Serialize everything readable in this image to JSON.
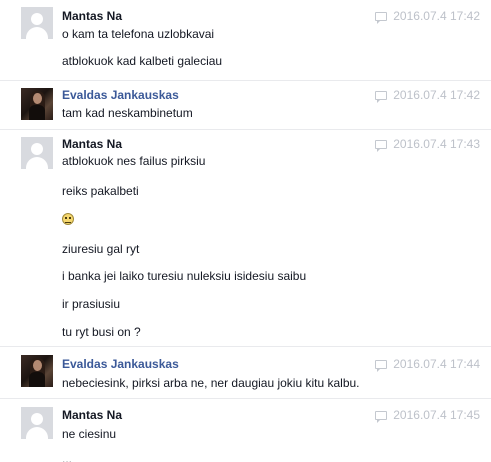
{
  "messages": [
    {
      "sender": "Mantas Na",
      "timestamp": "2016.07.4 17:42",
      "lines": [
        "o kam ta telefona uzlobkavai",
        "atblokuok kad kalbeti galeciau"
      ]
    },
    {
      "sender": "Evaldas Jankauskas",
      "timestamp": "2016.07.4 17:42",
      "lines": [
        "tam kad neskambinetum"
      ]
    },
    {
      "sender": "Mantas Na",
      "timestamp": "2016.07.4 17:43",
      "lines": [
        "atblokuok nes failus pirksiu",
        "reiks pakalbeti",
        "",
        "ziuresiu gal ryt",
        "i banka jei laiko turesiu nuleksiu isidesiu saibu",
        "ir prasiusiu",
        "tu ryt busi on ?"
      ]
    },
    {
      "sender": "Evaldas Jankauskas",
      "timestamp": "2016.07.4 17:44",
      "lines": [
        "nebeciesink, pirksi arba ne, ner daugiau jokiu kitu kalbu."
      ]
    },
    {
      "sender": "Mantas Na",
      "timestamp": "2016.07.4 17:45",
      "lines": [
        "ne ciesinu",
        "..."
      ]
    }
  ],
  "icons": {
    "timestamp_icon": "speech-bubble-icon",
    "emoji_icon": "smiley-face-icon",
    "default_avatar": "default-avatar-icon"
  },
  "colors": {
    "sender_default": "#141823",
    "sender_link": "#3b5998",
    "timestamp": "#bdc1c9",
    "separator": "#e9eaed"
  }
}
